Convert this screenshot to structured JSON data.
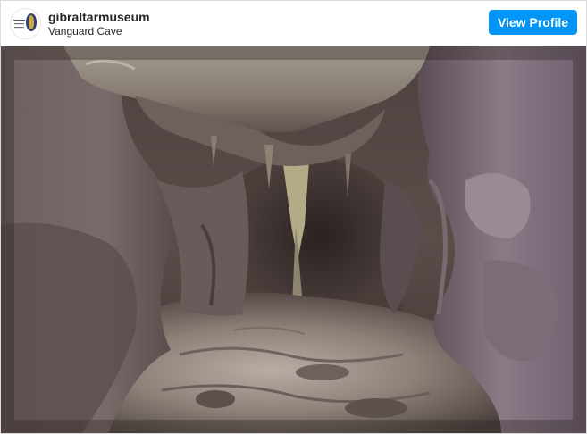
{
  "post_header": {
    "username": "gibraltarmuseum",
    "location": "Vanguard Cave",
    "view_profile_label": "View Profile",
    "accent_color": "#0095f6"
  },
  "avatar": {
    "icon": "gibraltar-national-museum-logo"
  },
  "photo": {
    "subject": "cave-photo"
  }
}
